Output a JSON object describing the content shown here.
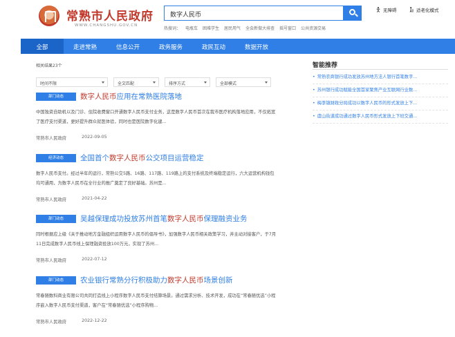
{
  "header": {
    "site_title": "常熟市人民政府",
    "site_url": "WWW.CHANGSHU.GOV.CN",
    "search_value": "数字人民币",
    "hot_label": "热搜词：",
    "hot_words": [
      "电瓶车",
      "困难学生",
      "居民用气",
      "全会新做大排查",
      "摇号窗口",
      "公共资源交易"
    ],
    "accessibility_label": "无障碍",
    "elder_label": "适老化模式"
  },
  "nav": {
    "items": [
      "全部",
      "走进常熟",
      "信息公开",
      "政务服务",
      "政民互动",
      "数据开放"
    ]
  },
  "results": {
    "count_text": "相关结果23个",
    "filters": [
      "时间不限",
      "全文匹配",
      "排序方式",
      "全部模式"
    ],
    "items": [
      {
        "tag": "部门动态",
        "title_pre": "",
        "title_hl": "数字人民币",
        "title_post": "应用在常熟医院落地",
        "summary": "中国独资自助机以及门诊、住院收费窗口开通数字人民币支付业务，这是数字人民币首次在我市医疗机构落地应用，不仅拓宽了医疗支付渠道，更好提升群众就医体验，同时也是医院数字化建...",
        "source": "常熟市人民政府",
        "date": "2022-09-05"
      },
      {
        "tag": "经济动态",
        "title_pre": "全国首个",
        "title_hl": "数字人民币",
        "title_post": "公交项目运营稳定",
        "summary": "数字人民币支付。经过半年的运行，常熟公交5路、16路、117路、119路上的支付系统及终端稳定运行，六大运营机构钱包均可通用，为数字人民币在全行业的推广奠定了良好基础。苏州是...",
        "source": "常熟市人民政府",
        "date": "2021-04-22"
      },
      {
        "tag": "部门动态",
        "title_pre": "吴越保理成功投放苏州首笔",
        "title_hl": "数字人民币",
        "title_post": "保理融资业务",
        "summary": "同时根据应上级《关于推动地方金融组织运用数字人民币的倡导书》，加强数字人民币相关政策学习，并主动对接客户，于7月11日完成数字人民币线上保理融资投放100万元，实现了苏州...",
        "source": "常熟市人民政府",
        "date": "2022-07-12"
      },
      {
        "tag": "部门动态",
        "title_pre": "农业银行常熟分行积极助力",
        "title_hl": "数字人民币",
        "title_post": "场景创新",
        "summary": "常春随数科商业有限公司共同打造线上小程序数字人民币支付结算场景。通过需求分析、技术开发，成功在“常春随优选”小程序嵌入数字人民币支付渠道，客户在“常春随优选”小程序购物...",
        "source": "常熟市人民政府",
        "date": "2022-12-22"
      }
    ]
  },
  "sidebar": {
    "title": "智能推荐",
    "items": [
      "常熟农商银行成功发放苏州地方法人银行首笔数字...",
      "苏州银行成功赋能全国首家聚焦产业互联网行业数...",
      "梅李镇财政分局成功以数字人民币的形式发放上下...",
      "虞山街道成功通过数字人民币形式发放上下班交通..."
    ]
  },
  "colors": {
    "brand_blue": "#2f7fe6",
    "title_red": "#c0392b"
  }
}
